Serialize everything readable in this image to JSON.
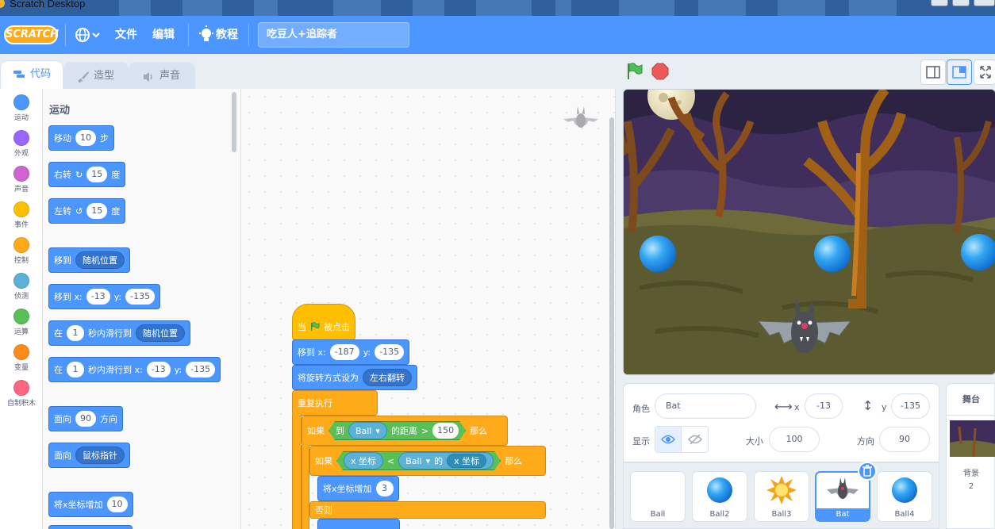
{
  "window": {
    "title": "Scratch Desktop"
  },
  "menubar": {
    "logo": "SCRATCH",
    "file": "文件",
    "edit": "编辑",
    "tutorials": "教程",
    "project_title": "吃豆人+追踪者"
  },
  "tabs": [
    {
      "label": "代码",
      "icon": "code-icon",
      "active": true
    },
    {
      "label": "造型",
      "icon": "brush-icon",
      "active": false
    },
    {
      "label": "声音",
      "icon": "speaker-icon",
      "active": false
    }
  ],
  "categories": [
    {
      "label": "运动",
      "color": "#4c97ff"
    },
    {
      "label": "外观",
      "color": "#9966ff"
    },
    {
      "label": "声音",
      "color": "#cf63cf"
    },
    {
      "label": "事件",
      "color": "#ffbf00"
    },
    {
      "label": "控制",
      "color": "#ffab19"
    },
    {
      "label": "侦测",
      "color": "#5cb1d6"
    },
    {
      "label": "运算",
      "color": "#59c059"
    },
    {
      "label": "变量",
      "color": "#ff8c1a"
    },
    {
      "label": "自制积木",
      "color": "#ff6680"
    }
  ],
  "palette": {
    "heading": "运动",
    "move": {
      "a": "移动",
      "n": "10",
      "b": "步"
    },
    "turn_right": {
      "a": "右转",
      "n": "15",
      "b": "度"
    },
    "turn_left": {
      "a": "左转",
      "n": "15",
      "b": "度"
    },
    "goto": {
      "a": "移到",
      "target": "随机位置"
    },
    "goto_xy": {
      "a": "移到 x:",
      "x": "-13",
      "yl": "y:",
      "y": "-135"
    },
    "glide_to": {
      "a": "在",
      "n": "1",
      "b": "秒内滑行到",
      "target": "随机位置"
    },
    "glide_xy": {
      "a": "在",
      "n": "1",
      "b": "秒内滑行到 x:",
      "x": "-13",
      "yl": "y:",
      "y": "-135"
    },
    "point_dir": {
      "a": "面向",
      "n": "90",
      "b": "方向"
    },
    "point_towards": {
      "a": "面向",
      "target": "鼠标指针"
    },
    "change_x": {
      "a": "将x坐标增加",
      "n": "10"
    }
  },
  "script": {
    "hat": {
      "a": "当",
      "b": "被点击"
    },
    "goto_xy": {
      "a": "移到 x:",
      "x": "-187",
      "yl": "y:",
      "y": "-135"
    },
    "rotation": {
      "a": "将旋转方式设为",
      "style": "左右翻转"
    },
    "forever": "重复执行",
    "if1": {
      "a": "如果",
      "to": "到",
      "target": "Ball",
      "dist": "的距离",
      "op": ">",
      "n": "150",
      "then": "那么"
    },
    "if2": {
      "a": "如果",
      "xpos": "x 坐标",
      "op": "<",
      "obj": "Ball",
      "of": "的",
      "prop": "x 坐标",
      "then": "那么"
    },
    "changex": {
      "a": "将x坐标增加",
      "n": "3"
    },
    "else": "否则"
  },
  "sprite_info": {
    "sprite_label": "角色",
    "sprite_name": "Bat",
    "x_label": "x",
    "x": "-13",
    "y_label": "y",
    "y": "-135",
    "show_label": "显示",
    "size_label": "大小",
    "size": "100",
    "direction_label": "方向",
    "direction": "90"
  },
  "sprites": [
    {
      "name": "Ball",
      "selected": false
    },
    {
      "name": "Ball2",
      "selected": false
    },
    {
      "name": "Ball3",
      "selected": false
    },
    {
      "name": "Bat",
      "selected": true
    },
    {
      "name": "Ball4",
      "selected": false
    }
  ],
  "stage_panel": {
    "title": "舞台",
    "backdrops_label": "背景",
    "backdrops_count": "2"
  },
  "colors": {
    "accent": "#4c97ff",
    "motion": "#4c97ff",
    "control": "#ffab19",
    "operators": "#59c059",
    "sensing": "#5cb1d6",
    "events": "#ffbf00"
  }
}
